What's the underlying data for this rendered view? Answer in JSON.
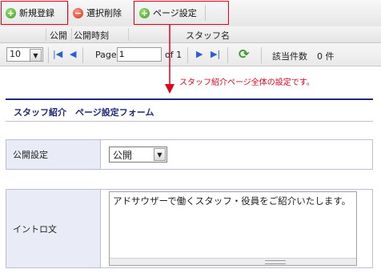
{
  "toolbar": {
    "new_label": "新規登録",
    "delete_label": "選択削除",
    "page_settings_label": "ページ設定",
    "colors": {
      "highlight": "#e0001c",
      "add_icon": "#3d9a1e",
      "delete_icon": "#d42a16"
    }
  },
  "grid": {
    "columns": [
      "公開",
      "公開時刻",
      "スタッフ名"
    ]
  },
  "pager": {
    "page_size": "10",
    "page_label": "Page",
    "current_page": "1",
    "of_label": "of 1",
    "count_label": "該当件数",
    "count_value": "0 件"
  },
  "annotation": "スタッフ紹介ページ全体の設定です。",
  "form": {
    "title": "スタッフ紹介　ページ設定フォーム",
    "title_color": "#1f2a7a",
    "publish": {
      "label": "公開設定",
      "value": "公開"
    },
    "intro": {
      "label": "イントロ文",
      "value": "アドサウザーで働くスタッフ・役員をご紹介いたします。"
    }
  }
}
